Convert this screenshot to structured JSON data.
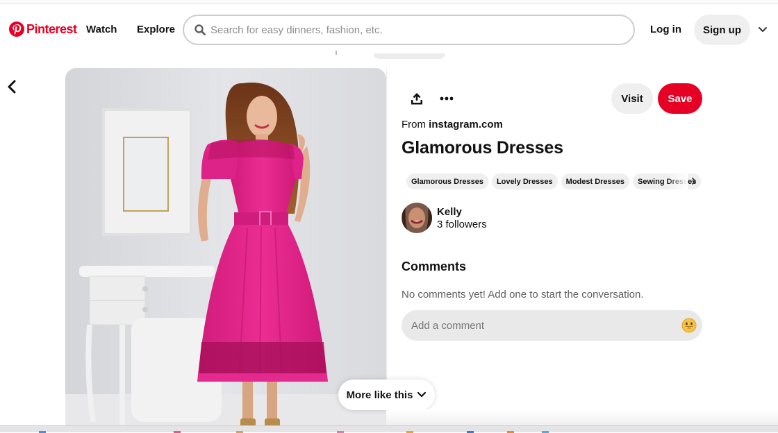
{
  "header": {
    "brand": "Pinterest",
    "nav": [
      "Watch",
      "Explore"
    ],
    "search_placeholder": "Search for easy dinners, fashion, etc.",
    "search_value": "",
    "login_label": "Log in",
    "signup_label": "Sign up"
  },
  "pin": {
    "image_alt": "Woman wearing a fuchsia pink midi dress with lace yoke, belt and lace hem band, standing beside a white vanity with ornate mirror",
    "source_prefix": "From",
    "source_domain": "instagram.com",
    "title": "Glamorous Dresses",
    "visit_label": "Visit",
    "save_label": "Save",
    "tags": [
      "Glamorous Dresses",
      "Lovely Dresses",
      "Modest Dresses",
      "Sewing Dresses"
    ]
  },
  "creator": {
    "name": "Kelly",
    "followers": "3 followers"
  },
  "comments": {
    "heading": "Comments",
    "empty_text": "No comments yet! Add one to start the conversation.",
    "input_placeholder": "Add a comment",
    "input_value": ""
  },
  "more_like_this_label": "More like this",
  "colors": {
    "brand_red": "#e60023",
    "button_gray": "#efefef",
    "dress_pink": "#e5238a"
  },
  "icons": {
    "logo": "pinterest-logo-icon",
    "search": "search-icon",
    "account_menu": "chevron-down-icon",
    "back": "chevron-left-icon",
    "share": "share-upload-icon",
    "more": "ellipsis-icon",
    "tags_next": "chevron-right-icon",
    "emoji": "smiley-emoji-icon",
    "more_like_this": "chevron-down-icon"
  }
}
